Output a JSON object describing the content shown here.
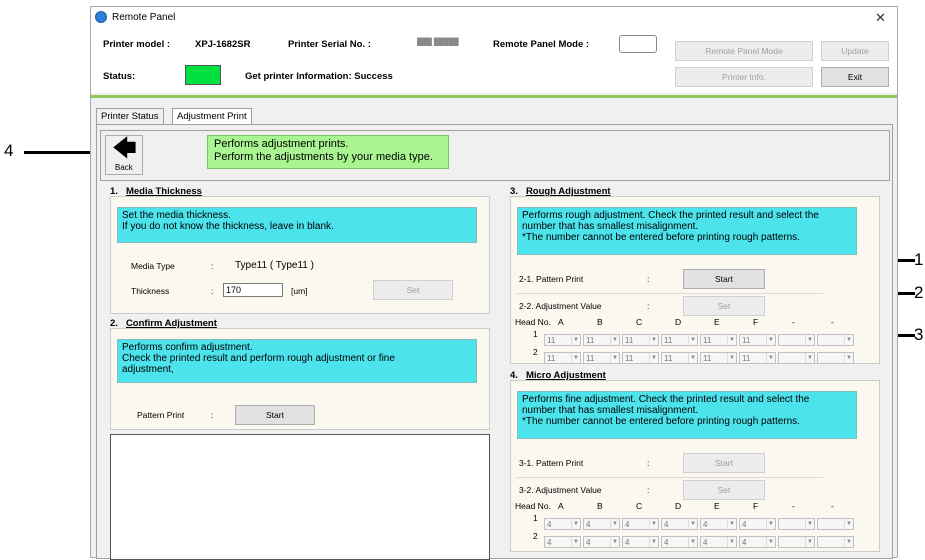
{
  "window": {
    "title": "Remote Panel"
  },
  "header": {
    "printer_model_label": "Printer model :",
    "printer_model_value": "XPJ-1682SR",
    "serial_label": "Printer Serial No. :",
    "serial_value": "███ █████",
    "mode_label": "Remote Panel Mode :",
    "status_label": "Status:",
    "status_text": "Get printer Information: Success",
    "status_color": "#00e040",
    "buttons": {
      "remote_panel_mode": "Remote Panel Mode",
      "update": "Update",
      "printer_info": "Printer Info.",
      "exit": "Exit"
    }
  },
  "tabs": [
    "Printer Status",
    "Adjustment Print"
  ],
  "back": {
    "label": "Back",
    "message": "Performs adjustment prints.\nPerform the adjustments by your media type."
  },
  "media_thickness": {
    "num": "1.",
    "title": "Media Thickness",
    "info": "Set the media thickness.\nIf you do not know the thickness, leave in blank.",
    "media_type_label": "Media Type",
    "media_type_value": "Type11 ( Type11 )",
    "thickness_label": "Thickness",
    "thickness_value": "170",
    "unit": "[um]",
    "set_button": "Set"
  },
  "confirm_adjustment": {
    "num": "2.",
    "title": "Confirm Adjustment",
    "info": "Performs confirm adjustment.\nCheck the printed result and perform rough adjustment or fine\nadjustment,",
    "pattern_print_label": "Pattern Print",
    "start_button": "Start"
  },
  "rough_adjustment": {
    "num": "3.",
    "title": "Rough Adjustment",
    "info": "Performs rough adjustment. Check the printed result and select the\nnumber that has smallest misalignment.\n  *The number cannot be entered before printing rough patterns.",
    "step1_label": "2-1.  Pattern Print",
    "step1_button": "Start",
    "step2_label": "2-2.  Adjustment Value",
    "step2_button": "Set",
    "head_no": "Head No.",
    "columns": [
      "A",
      "B",
      "C",
      "D",
      "E",
      "F",
      "-",
      "-"
    ],
    "rows": [
      {
        "no": "1",
        "values": [
          "11",
          "11",
          "11",
          "11",
          "11",
          "11",
          "",
          ""
        ]
      },
      {
        "no": "2",
        "values": [
          "11",
          "11",
          "11",
          "11",
          "11",
          "11",
          "",
          ""
        ]
      }
    ]
  },
  "micro_adjustment": {
    "num": "4.",
    "title": "Micro Adjustment",
    "info": "Performs fine adjustment. Check the printed result and select the\nnumber that has smallest misalignment.\n  *The number cannot be entered before printing rough patterns.",
    "step1_label": "3-1.  Pattern Print",
    "step1_button": "Start",
    "step2_label": "3-2.  Adjustment Value",
    "step2_button": "Set",
    "head_no": "Head No.",
    "columns": [
      "A",
      "B",
      "C",
      "D",
      "E",
      "F",
      "-",
      "-"
    ],
    "rows": [
      {
        "no": "1",
        "values": [
          "4",
          "4",
          "4",
          "4",
          "4",
          "4",
          "",
          ""
        ]
      },
      {
        "no": "2",
        "values": [
          "4",
          "4",
          "4",
          "4",
          "4",
          "4",
          "",
          ""
        ]
      }
    ]
  },
  "colon": ":",
  "annotations": [
    "1",
    "2",
    "3",
    "4"
  ]
}
